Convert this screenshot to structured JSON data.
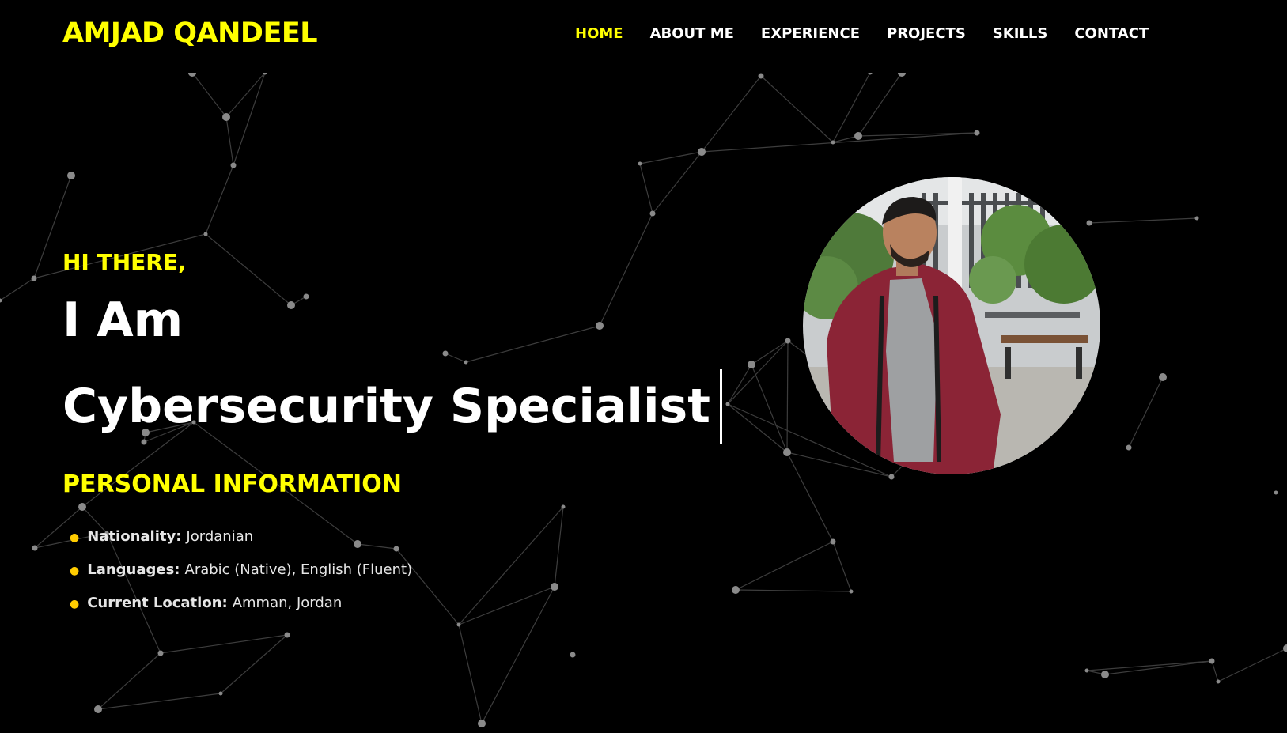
{
  "colors": {
    "background": "#000000",
    "accent": "#ffff00",
    "text": "#ffffff",
    "bullet": "#ffcc00"
  },
  "header": {
    "brand": "AMJAD QANDEEL",
    "nav": [
      {
        "label": "HOME",
        "active": true
      },
      {
        "label": "ABOUT ME",
        "active": false
      },
      {
        "label": "EXPERIENCE",
        "active": false
      },
      {
        "label": "PROJECTS",
        "active": false
      },
      {
        "label": "SKILLS",
        "active": false
      },
      {
        "label": "CONTACT",
        "active": false
      }
    ]
  },
  "hero": {
    "greeting": "HI THERE,",
    "headline_line1": "I Am",
    "headline_line2": "Cybersecurity Specialist"
  },
  "personal_info": {
    "title": "PERSONAL INFORMATION",
    "items": [
      {
        "label": "Nationality:",
        "value": "Jordanian"
      },
      {
        "label": "Languages:",
        "value": "Arabic (Native), English (Fluent)"
      },
      {
        "label": "Current Location:",
        "value": "Amman, Jordan"
      }
    ]
  },
  "profile_photo": {
    "icon": "profile-photo"
  }
}
